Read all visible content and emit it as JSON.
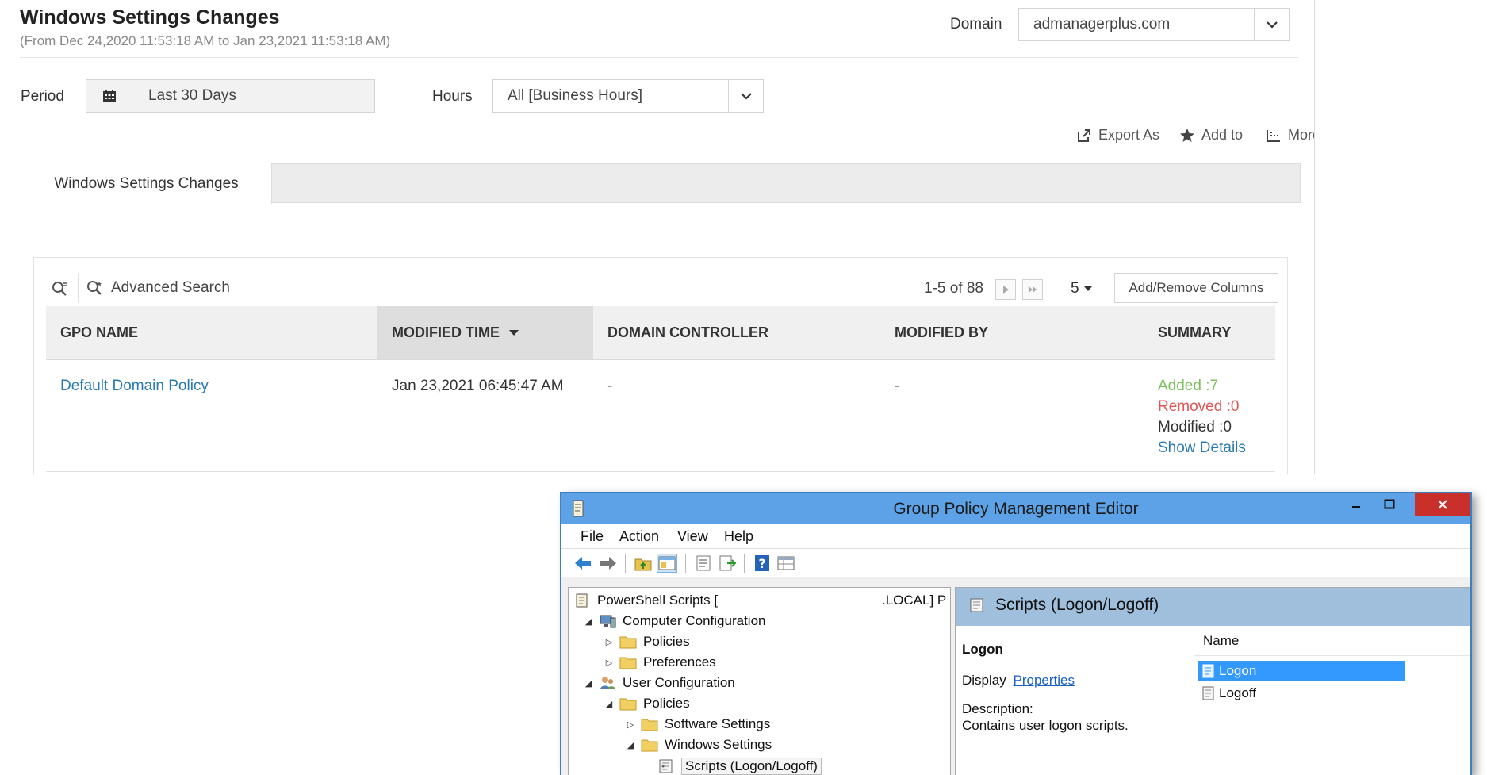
{
  "report": {
    "title": "Windows Settings Changes",
    "subtitle": "(From Dec 24,2020 11:53:18 AM to Jan 23,2021 11:53:18 AM)",
    "domain_label": "Domain",
    "domain_value": "admanagerplus.com",
    "period_label": "Period",
    "period_value": "Last 30 Days",
    "hours_label": "Hours",
    "hours_value": "All [Business Hours]",
    "actions": {
      "export": "Export As",
      "add_to": "Add to",
      "more": "More"
    },
    "tab_label": "Windows Settings Changes",
    "advanced_search": "Advanced Search",
    "pager": "1-5 of 88",
    "page_size": "5",
    "add_remove_columns": "Add/Remove Columns",
    "columns": [
      "GPO NAME",
      "MODIFIED TIME",
      "DOMAIN CONTROLLER",
      "MODIFIED BY",
      "SUMMARY"
    ],
    "rows": [
      {
        "gpo_name": "Default Domain Policy",
        "modified_time": "Jan 23,2021 06:45:47 AM",
        "domain_controller": "-",
        "modified_by": "-",
        "summary_added": "Added :7",
        "summary_removed": "Removed :0",
        "summary_modified": "Modified :0",
        "show_details": "Show Details"
      }
    ]
  },
  "gpme": {
    "title": "Group Policy Management Editor",
    "menu": [
      "File",
      "Action",
      "View",
      "Help"
    ],
    "tree": {
      "root_left": "PowerShell Scripts [",
      "root_right": ".LOCAL] P",
      "computer_configuration": "Computer Configuration",
      "cc_policies": "Policies",
      "cc_preferences": "Preferences",
      "user_configuration": "User Configuration",
      "uc_policies": "Policies",
      "software_settings": "Software Settings",
      "windows_settings": "Windows Settings",
      "scripts": "Scripts (Logon/Logoff)"
    },
    "right": {
      "header": "Scripts (Logon/Logoff)",
      "section_title": "Logon",
      "display_label": "Display",
      "properties_link": "Properties",
      "description_label": "Description:",
      "description_text": "Contains user logon scripts.",
      "list_header": "Name",
      "items": [
        "Logon",
        "Logoff"
      ]
    }
  },
  "colors": {
    "link": "#2a7ab0",
    "added": "#7bbf5a",
    "removed": "#e05555",
    "titlebar": "#5da2e6",
    "selection": "#3399ff"
  }
}
